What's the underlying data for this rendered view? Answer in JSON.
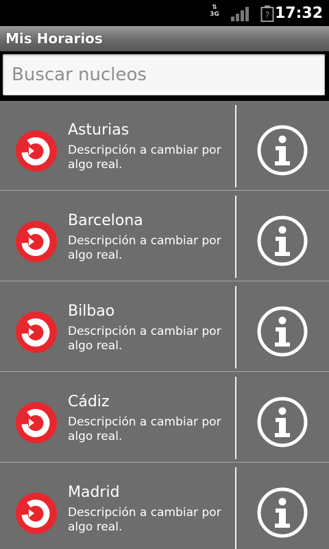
{
  "status_bar": {
    "network": "3G",
    "time": "17:32",
    "icons": [
      "data-arrows-icon",
      "signal-icon",
      "battery-unknown-icon"
    ]
  },
  "app": {
    "title": "Mis Horarios"
  },
  "search": {
    "placeholder": "Buscar nucleos",
    "value": ""
  },
  "items": [
    {
      "name": "Asturias",
      "description": "Descripción a cambiar por algo real."
    },
    {
      "name": "Barcelona",
      "description": "Descripción a cambiar por algo real."
    },
    {
      "name": "Bilbao",
      "description": "Descripción a cambiar por algo real."
    },
    {
      "name": "Cádiz",
      "description": "Descripción a cambiar por algo real."
    },
    {
      "name": "Madrid",
      "description": "Descripción a cambiar por algo real."
    }
  ],
  "colors": {
    "logo_red": "#e8262d",
    "list_bg": "#6d6d6d",
    "title_bar": "#6c6c6c"
  }
}
